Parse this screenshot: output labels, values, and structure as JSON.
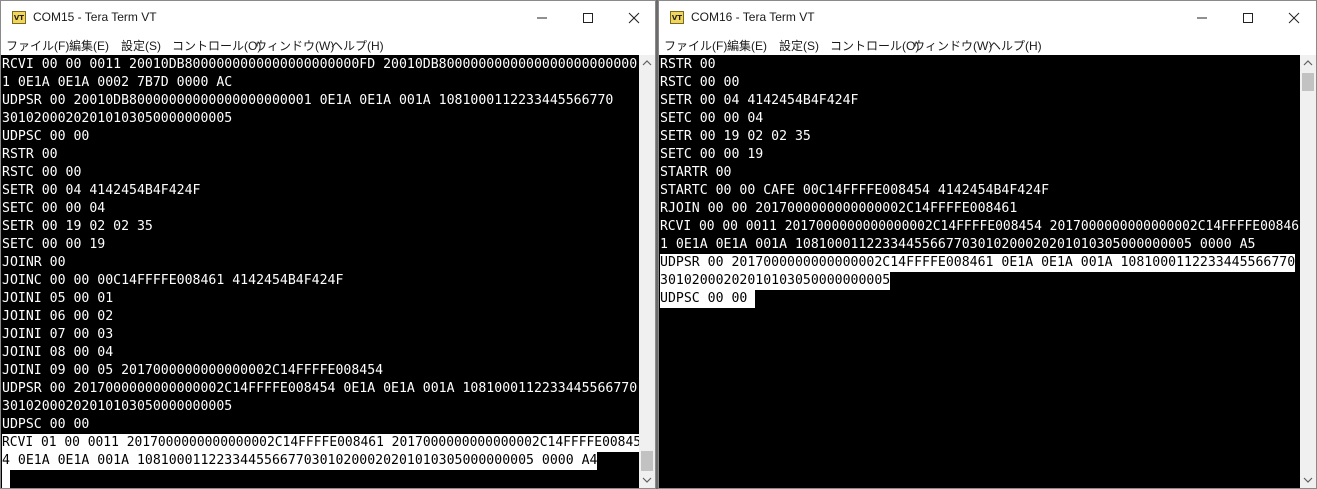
{
  "window1": {
    "title": "COM15 - Tera Term VT",
    "icon_text": "VT",
    "menu": [
      "ファイル(F)",
      "編集(E)",
      "設定(S)",
      "コントロール(O)",
      "ウィンドウ(W)",
      "ヘルプ(H)"
    ],
    "lines": [
      {
        "text": "RCVI 00 00 0011 20010DB8000000000000000000000FD 20010DB8000000000000000000000000",
        "selected": false
      },
      {
        "text": "1 0E1A 0E1A 0002 7B7D 0000 AC",
        "selected": false
      },
      {
        "text": "UDPSR 00 20010DB80000000000000000000001 0E1A 0E1A 001A 1081000112233445566770",
        "selected": false
      },
      {
        "text": "30102000202010103050000000005",
        "selected": false
      },
      {
        "text": "UDPSC 00 00",
        "selected": false
      },
      {
        "text": "RSTR 00",
        "selected": false
      },
      {
        "text": "RSTC 00 00",
        "selected": false
      },
      {
        "text": "SETR 00 04 4142454B4F424F",
        "selected": false
      },
      {
        "text": "SETC 00 00 04",
        "selected": false
      },
      {
        "text": "SETR 00 19 02 02 35",
        "selected": false
      },
      {
        "text": "SETC 00 00 19",
        "selected": false
      },
      {
        "text": "JOINR 00",
        "selected": false
      },
      {
        "text": "JOINC 00 00 00C14FFFFE008461 4142454B4F424F",
        "selected": false
      },
      {
        "text": "JOINI 05 00 01",
        "selected": false
      },
      {
        "text": "JOINI 06 00 02",
        "selected": false
      },
      {
        "text": "JOINI 07 00 03",
        "selected": false
      },
      {
        "text": "JOINI 08 00 04",
        "selected": false
      },
      {
        "text": "JOINI 09 00 05 2017000000000000002C14FFFFE008454",
        "selected": false
      },
      {
        "text": "UDPSR 00 2017000000000000002C14FFFFE008454 0E1A 0E1A 001A 1081000112233445566770",
        "selected": false
      },
      {
        "text": "30102000202010103050000000005",
        "selected": false
      },
      {
        "text": "UDPSC 00 00",
        "selected": false
      },
      {
        "text": "RCVI 01 00 0011 2017000000000000002C14FFFFE008461 2017000000000000002C14FFFFE00845",
        "selected": true
      },
      {
        "text": "4 0E1A 0E1A 001A 10810001122334455667703010200020201010305000000005 0000 A4",
        "selected": true
      },
      {
        "text": " ",
        "selected": true
      }
    ]
  },
  "window2": {
    "title": "COM16 - Tera Term VT",
    "icon_text": "VT",
    "menu": [
      "ファイル(F)",
      "編集(E)",
      "設定(S)",
      "コントロール(O)",
      "ウィンドウ(W)",
      "ヘルプ(H)"
    ],
    "lines": [
      {
        "text": "RSTR 00",
        "selected": false
      },
      {
        "text": "RSTC 00 00",
        "selected": false
      },
      {
        "text": "SETR 00 04 4142454B4F424F",
        "selected": false
      },
      {
        "text": "SETC 00 00 04",
        "selected": false
      },
      {
        "text": "SETR 00 19 02 02 35",
        "selected": false
      },
      {
        "text": "SETC 00 00 19",
        "selected": false
      },
      {
        "text": "STARTR 00",
        "selected": false
      },
      {
        "text": "STARTC 00 00 CAFE 00C14FFFFE008454 4142454B4F424F",
        "selected": false
      },
      {
        "text": "RJOIN 00 00 2017000000000000002C14FFFFE008461",
        "selected": false
      },
      {
        "text": "RCVI 00 00 0011 2017000000000000002C14FFFFE008454 2017000000000000002C14FFFFE00846",
        "selected": false
      },
      {
        "text": "1 0E1A 0E1A 001A 10810001122334455667703010200020201010305000000005 0000 A5",
        "selected": false
      },
      {
        "text": "UDPSR 00 2017000000000000002C14FFFFE008461 0E1A 0E1A 001A 1081000112233445566770",
        "selected": true
      },
      {
        "text": "30102000202010103050000000005",
        "selected": true
      },
      {
        "text": "UDPSC 00 00 ",
        "selected": true
      }
    ]
  }
}
